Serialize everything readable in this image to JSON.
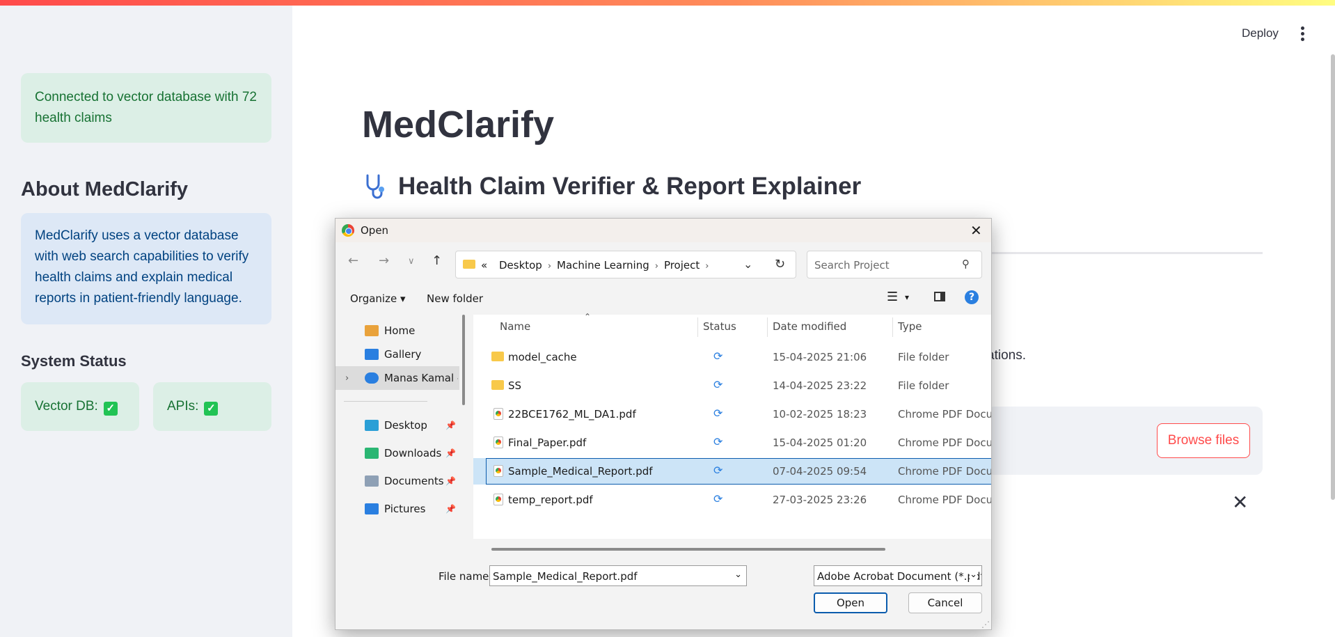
{
  "app": {
    "deploy_label": "Deploy",
    "title": "MedClarify",
    "subtitle": "Health Claim Verifier & Report Explainer",
    "partial_text": "ations.",
    "browse_label": "Browse files",
    "close_glyph": "✕"
  },
  "sidebar": {
    "connection_alert": "Connected to vector database with 72 health claims",
    "about_heading": "About MedClarify",
    "about_text": "MedClarify uses a vector database with web search capabilities to verify health claims and explain medical reports in patient-friendly language.",
    "status_heading": "System Status",
    "vector_db_label": "Vector DB:",
    "apis_label": "APIs:",
    "check_glyph": "✓"
  },
  "dialog": {
    "title": "Open",
    "close_glyph": "✕",
    "breadcrumb": [
      "Desktop",
      "Machine Learning",
      "Project"
    ],
    "breadcrumb_overflow": "«",
    "search_placeholder": "Search Project",
    "organize_label": "Organize ▾",
    "new_folder_label": "New folder",
    "help_glyph": "?",
    "nav": [
      {
        "label": "Home",
        "color": "#e9a23b"
      },
      {
        "label": "Gallery",
        "color": "#2a7fe0"
      },
      {
        "label": "Manas Kamal - P",
        "color": "#2a7fe0"
      },
      {
        "label": "Desktop",
        "color": "#2a9fd6"
      },
      {
        "label": "Downloads",
        "color": "#2bb673"
      },
      {
        "label": "Documents",
        "color": "#8ea0b5"
      },
      {
        "label": "Pictures",
        "color": "#2a7fe0"
      }
    ],
    "columns": {
      "name": "Name",
      "status": "Status",
      "date": "Date modified",
      "type": "Type"
    },
    "files": [
      {
        "name": "model_cache",
        "status": "⟳",
        "date": "15-04-2025 21:06",
        "type": "File folder",
        "kind": "folder"
      },
      {
        "name": "SS",
        "status": "⟳",
        "date": "14-04-2025 23:22",
        "type": "File folder",
        "kind": "folder"
      },
      {
        "name": "22BCE1762_ML_DA1.pdf",
        "status": "⟳",
        "date": "10-02-2025 18:23",
        "type": "Chrome PDF Docu",
        "kind": "pdf"
      },
      {
        "name": "Final_Paper.pdf",
        "status": "⟳",
        "date": "15-04-2025 01:20",
        "type": "Chrome PDF Docu",
        "kind": "pdf"
      },
      {
        "name": "Sample_Medical_Report.pdf",
        "status": "⟳",
        "date": "07-04-2025 09:54",
        "type": "Chrome PDF Docu",
        "kind": "pdf",
        "selected": true
      },
      {
        "name": "temp_report.pdf",
        "status": "⟳",
        "date": "27-03-2025 23:26",
        "type": "Chrome PDF Docu",
        "kind": "pdf"
      }
    ],
    "file_name_label": "File name:",
    "file_name_value": "Sample_Medical_Report.pdf",
    "file_type_value": "Adobe Acrobat Document (*.pdf)",
    "open_label": "Open",
    "cancel_label": "Cancel"
  },
  "colors": {
    "accent": "#ff4b4b",
    "success_bg": "#dcefe6",
    "info_bg": "#dde8f6",
    "selection": "#cce4f7"
  }
}
